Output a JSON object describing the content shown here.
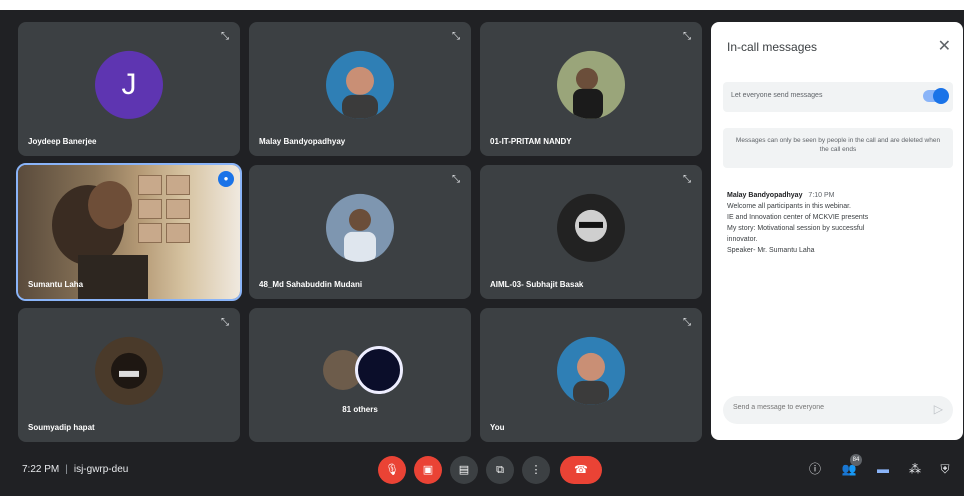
{
  "participants": [
    {
      "name": "Joydeep Banerjee",
      "initial": "J",
      "type": "letter"
    },
    {
      "name": "Malay Bandyopadhyay",
      "type": "photo",
      "color": "#2f7fb5"
    },
    {
      "name": "01-IT-PRITAM NANDY",
      "type": "photo",
      "color": "#9aa57a"
    },
    {
      "name": "Sumantu Laha",
      "type": "video"
    },
    {
      "name": "48_Md Sahabuddin Mudani",
      "type": "photo",
      "color": "#7e96b0"
    },
    {
      "name": "AIML-03- Subhajit Basak",
      "type": "photo",
      "color": "#222222"
    },
    {
      "name": "Soumyadip hapat",
      "type": "photo",
      "color": "#4a3a2a"
    },
    {
      "name": "81 others",
      "type": "others"
    },
    {
      "name": "You",
      "type": "photo",
      "color": "#2f7fb5"
    }
  ],
  "panel": {
    "title": "In-call messages",
    "close": "✕",
    "toggle_label": "Let everyone send messages",
    "notice": "Messages can only be seen by people in the call and are deleted when the call ends",
    "message": {
      "sender": "Malay Bandyopadhyay",
      "time": "7:10 PM",
      "lines": [
        "Welcome all participants in this webinar.",
        "IE and Innovation center of MCKVIE presents",
        "My story: Motivational session by successful",
        "innovator.",
        "Speaker- Mr. Sumantu Laha"
      ]
    },
    "input_placeholder": "Send a message to everyone",
    "send_icon": "send-icon"
  },
  "bottom": {
    "time": "7:22 PM",
    "separator": "|",
    "meeting_code": "isj-gwrp-deu",
    "people_count": "84"
  }
}
